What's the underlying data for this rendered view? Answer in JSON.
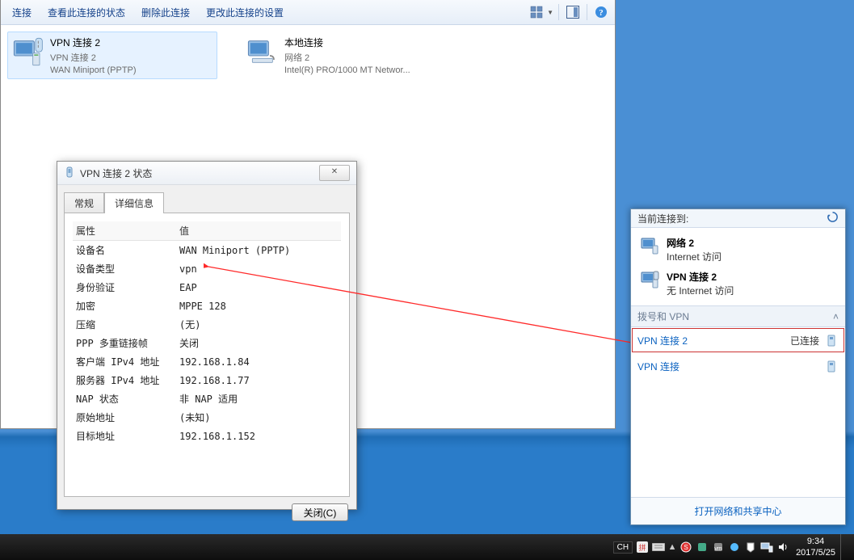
{
  "explorer": {
    "menu": {
      "connect": "连接",
      "view_status": "查看此连接的状态",
      "delete": "删除此连接",
      "change_settings": "更改此连接的设置"
    },
    "conn1": {
      "title": "VPN 连接 2",
      "sub1": "VPN 连接 2",
      "sub2": "WAN Miniport (PPTP)"
    },
    "conn2": {
      "title": "本地连接",
      "sub1": "网络  2",
      "sub2": "Intel(R) PRO/1000 MT Networ..."
    }
  },
  "dialog": {
    "title": "VPN 连接 2 状态",
    "tab_general": "常规",
    "tab_details": "详细信息",
    "col_property": "属性",
    "col_value": "值",
    "rows": {
      "r0": {
        "p": "设备名",
        "v": "WAN Miniport (PPTP)"
      },
      "r1": {
        "p": "设备类型",
        "v": "vpn"
      },
      "r2": {
        "p": "身份验证",
        "v": "EAP"
      },
      "r3": {
        "p": "加密",
        "v": "MPPE 128"
      },
      "r4": {
        "p": "压缩",
        "v": "(无)"
      },
      "r5": {
        "p": "PPP 多重链接帧",
        "v": "关闭"
      },
      "r6": {
        "p": "客户端 IPv4 地址",
        "v": "192.168.1.84"
      },
      "r7": {
        "p": "服务器 IPv4 地址",
        "v": "192.168.1.77"
      },
      "r8": {
        "p": "NAP 状态",
        "v": "非 NAP 适用"
      },
      "r9": {
        "p": "原始地址",
        "v": "(未知)"
      },
      "r10": {
        "p": "目标地址",
        "v": "192.168.1.152"
      }
    },
    "close_btn": "关闭(C)"
  },
  "netfly": {
    "header": "当前连接到:",
    "net1": {
      "name": "网络  2",
      "desc": "Internet 访问"
    },
    "net2": {
      "name": "VPN 连接 2",
      "desc": "无 Internet 访问"
    },
    "section": "拨号和 VPN",
    "vpn1": {
      "name": "VPN 连接 2",
      "status": "已连接"
    },
    "vpn2": {
      "name": "VPN 连接"
    },
    "footer": "打开网络和共享中心"
  },
  "taskbar": {
    "lang": "CH",
    "time": "9:34",
    "date": "2017/5/25"
  }
}
